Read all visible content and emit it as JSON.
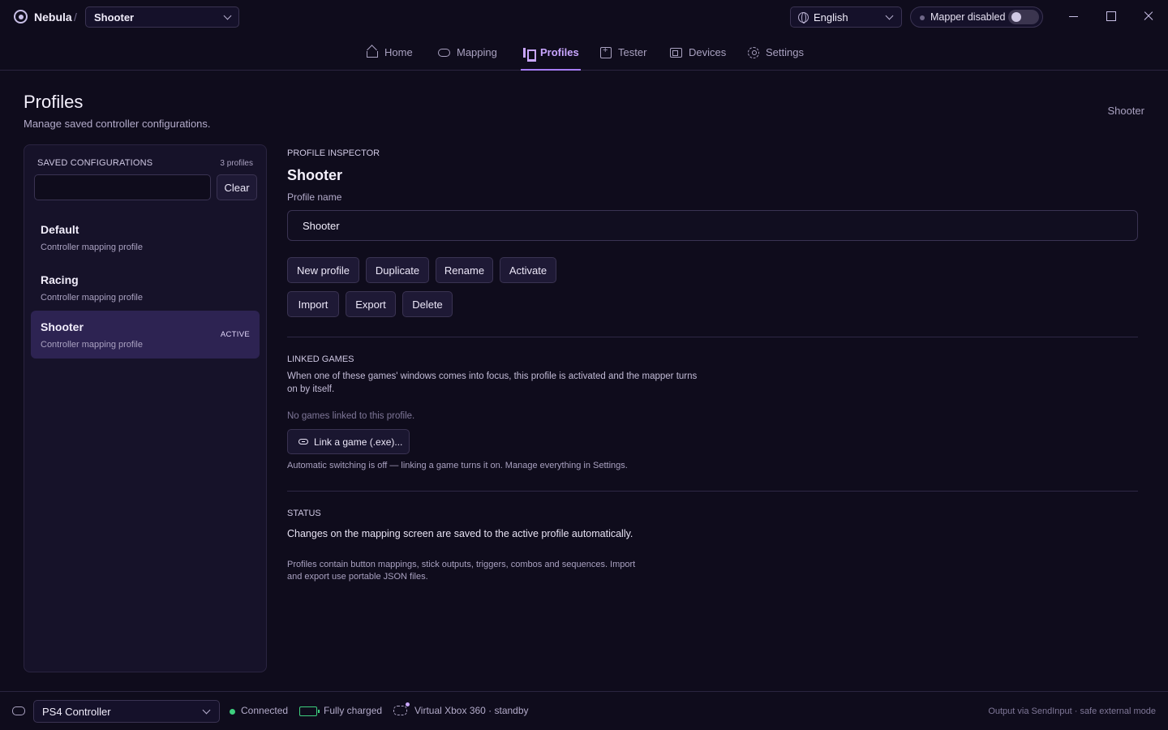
{
  "titlebar": {
    "app_name": "Nebula",
    "separator": "/",
    "current_profile": "Shooter",
    "language": "English",
    "mapper_status": "Mapper disabled",
    "mapper_enabled": false
  },
  "nav": {
    "tabs": [
      {
        "label": "Home",
        "icon": "home-icon"
      },
      {
        "label": "Mapping",
        "icon": "gamepad-icon"
      },
      {
        "label": "Profiles",
        "icon": "profiles-icon",
        "active": true
      },
      {
        "label": "Tester",
        "icon": "tester-icon"
      },
      {
        "label": "Devices",
        "icon": "devices-icon"
      },
      {
        "label": "Settings",
        "icon": "gear-icon"
      }
    ]
  },
  "page": {
    "title": "Profiles",
    "subtitle": "Manage saved controller configurations.",
    "current": "Shooter"
  },
  "sidebar": {
    "heading": "SAVED CONFIGURATIONS",
    "count": "3 profiles",
    "search_value": "",
    "clear_label": "Clear",
    "items": [
      {
        "name": "Default",
        "desc": "Controller mapping profile",
        "badge": ""
      },
      {
        "name": "Racing",
        "desc": "Controller mapping profile",
        "badge": ""
      },
      {
        "name": "Shooter",
        "desc": "Controller mapping profile",
        "badge": "ACTIVE"
      }
    ]
  },
  "inspector": {
    "label": "PROFILE INSPECTOR",
    "title": "Shooter",
    "name_label": "Profile name",
    "name_value": "Shooter",
    "buttons_row1": [
      "New profile",
      "Duplicate",
      "Rename",
      "Activate"
    ],
    "buttons_row2": [
      "Import",
      "Export",
      "Delete"
    ]
  },
  "linked_games": {
    "heading": "LINKED GAMES",
    "description_line1": "When one of these games' windows comes into focus, this profile is activated and the mapper turns",
    "description_line2": "on by itself.",
    "empty": "No games linked to this profile.",
    "link_button": "Link a game (.exe)...",
    "note": "Automatic switching is off — linking a game turns it on. Manage everything in Settings."
  },
  "status": {
    "heading": "STATUS",
    "message": "Changes on the mapping screen are saved to the active profile automatically.",
    "info_line1": "Profiles contain button mappings, stick outputs, triggers, combos and sequences. Import",
    "info_line2": "and export use portable JSON files."
  },
  "statusbar": {
    "controller": "PS4 Controller",
    "connection": "Connected",
    "battery": "Fully charged",
    "battery_level": 1.0,
    "virtual": "Virtual Xbox 360 · standby",
    "output": "Output via SendInput · safe external mode"
  },
  "colors": {
    "accent": "#a67cf5",
    "connected": "#3ecf7e",
    "background": "#0f0c1c"
  }
}
